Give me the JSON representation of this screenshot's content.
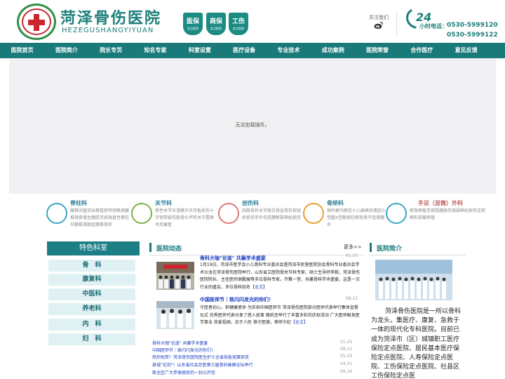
{
  "header": {
    "logo_title": "菏泽骨伤医院",
    "logo_sub": "HEZEGUSHANGYIYUAN",
    "badges": [
      {
        "main": "医保",
        "sub": "定点医院"
      },
      {
        "main": "商保",
        "sub": "定点医院"
      },
      {
        "main": "工伤",
        "sub": "定点医院"
      }
    ],
    "follow_label": "关注我们",
    "hours_label": "小时电话：",
    "phone_1": "0530-5999120",
    "phone_2": "0530-5999122"
  },
  "nav": [
    "医院首页",
    "医院简介",
    "院长专页",
    "知名专家",
    "科室设置",
    "医疗设备",
    "专业技术",
    "成功案例",
    "医院荣誉",
    "合作医疗",
    "意见反馈"
  ],
  "banner": {
    "message": "无法加载插件。"
  },
  "departments": [
    {
      "name": "脊柱科",
      "desc": "腰椎间盘突出椎管狭窄颈椎病腰椎骨质增生腰肌劳损强直性脊柱炎腰椎滑脱症腰椎骨折",
      "color": "#3aa7c0",
      "name_color": "#2f7f9a"
    },
    {
      "name": "关节科",
      "desc": "骨性关节炎滑膜炎半月板损伤十字韧带损伤股骨头坏死关节置换术后康复",
      "color": "#7db24a",
      "name_color": "#2f7f9a"
    },
    {
      "name": "创伤科",
      "desc": "四肢骨折关节脱位骨盆骨折软组织损伤手外伤肌腱断裂神经损伤",
      "color": "#e07a7a",
      "name_color": "#2f7f9a"
    },
    {
      "name": "骨矫科",
      "desc": "拇外翻马蹄足小儿麻痹后遗症O型腿X型腿脊柱侧弯骨不连骨髓炎",
      "color": "#e8a030",
      "name_color": "#2f7f9a"
    },
    {
      "name": "手足（显微）外科",
      "desc": "断指再植手部肌腱损伤周围神经损伤足部畸形皮瓣移植",
      "color": "#3aa7c0",
      "name_color": "#c06060"
    }
  ],
  "sidebar": {
    "title": "特色科室",
    "items": [
      "骨　科",
      "康复科",
      "中医科",
      "养老科",
      "内　科",
      "妇　科"
    ]
  },
  "news": {
    "title": "医院动态",
    "more": "更多>>",
    "featured": [
      {
        "date": "01.25",
        "headline": "骨科大咖\"论道\" 共襄学术盛宴",
        "body": "1月19日，菏泽市医学会小儿骨科专业委员会暨菏泽市民营医院协会骨科专业委员会学术沙龙在菏泽骨伤医院举行，山东省立医院骨关节科专家、硕士生导师李毅，菏泽骨伤医院院长、主任医师谢鹏展等多位骨科专家，齐聚一堂，共襄骨科学术盛宴。这是一次行业的盛会，多位骨科知名",
        "link": "【全文】"
      },
      {
        "date": "08.21",
        "headline": "中国医师节｜致闪闪发光的你们！",
        "body": "守医者初心，担健康使命 为庆祝中国医师节 菏泽骨伤医院部分医师代表举行集体宣誓仪式 优秀医师代表分享了感人故事 随后还举行了丰富多彩的庆祝活动 广大医师献身医学事业 热爱祖国，忠于人民 恪守医德，尊师守纪",
        "link": "【全文】"
      }
    ],
    "list": [
      {
        "text": "骨科大咖\"论道\" 共襄学术盛宴",
        "date": "01.25"
      },
      {
        "text": "中国医师节｜致闪闪发光的你们!",
        "date": "08.21"
      },
      {
        "text": "热烈祝贺！菏泽骨伤医院医生护士全省技能竞赛获奖",
        "date": "05.24"
      },
      {
        "text": "泉城\"论剑\"！山东省社会办医第三届骨科高峰论坛举行",
        "date": "04.01"
      },
      {
        "text": "致全区广大参保居民的一封公开信",
        "date": "09.16"
      }
    ]
  },
  "intro": {
    "title": "医院简介",
    "text": "菏泽骨伤医院是一所以骨科为龙头，集医疗、康复、急救于一体的现代化专科医院。目前已成为菏泽市（区）城镇职工医疗保险定点医院、居民基本医疗保险定点医院、人寿保险定点医院、工伤保险定点医院、社县区工伤保险定点医"
  }
}
